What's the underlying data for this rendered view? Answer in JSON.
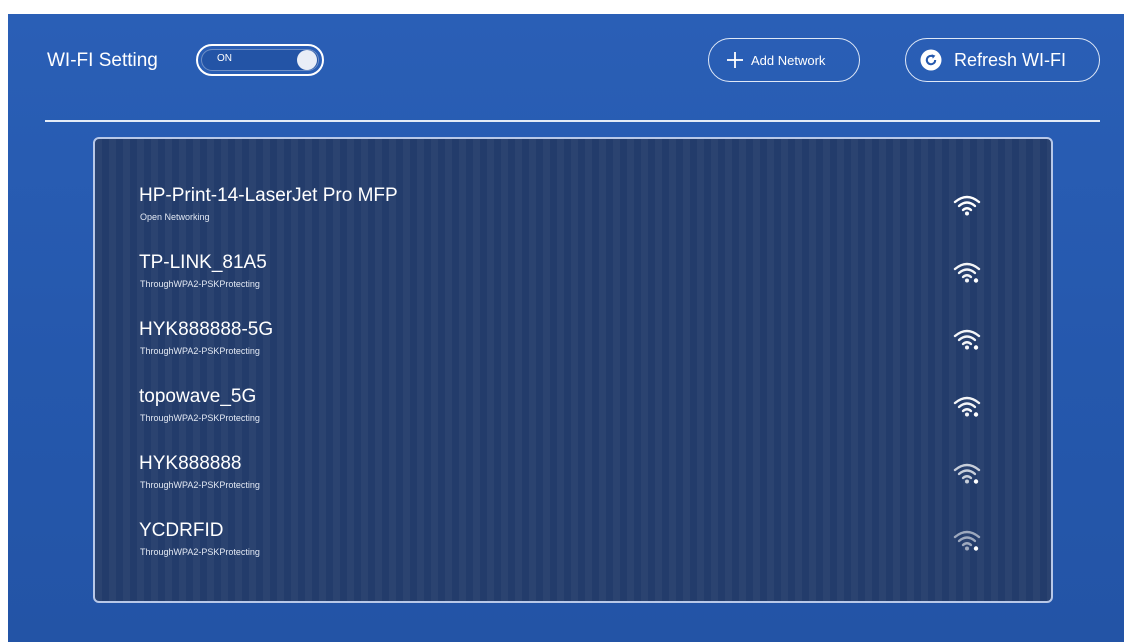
{
  "header": {
    "title": "WI-FI Setting",
    "toggle_label": "ON",
    "add_network_label": "Add Network",
    "refresh_label": "Refresh WI-FI"
  },
  "colors": {
    "background": "#2558ad",
    "panel": "#233c6b",
    "text": "#ffffff"
  },
  "networks": [
    {
      "name": "HP-Print-14-LaserJet Pro MFP",
      "security": "Open Networking",
      "icon": "wifi-icon",
      "secured": false,
      "signal": 1.0
    },
    {
      "name": "TP-LINK_81A5",
      "security": "ThroughWPA2-PSKProtecting",
      "icon": "wifi-lock-icon",
      "secured": true,
      "signal": 0.95
    },
    {
      "name": "HYK888888-5G",
      "security": "ThroughWPA2-PSKProtecting",
      "icon": "wifi-lock-icon",
      "secured": true,
      "signal": 0.95
    },
    {
      "name": "topowave_5G",
      "security": "ThroughWPA2-PSKProtecting",
      "icon": "wifi-lock-icon",
      "secured": true,
      "signal": 0.95
    },
    {
      "name": "HYK888888",
      "security": "ThroughWPA2-PSKProtecting",
      "icon": "wifi-lock-icon",
      "secured": true,
      "signal": 0.75
    },
    {
      "name": "YCDRFID",
      "security": "ThroughWPA2-PSKProtecting",
      "icon": "wifi-lock-icon",
      "secured": true,
      "signal": 0.55
    }
  ]
}
